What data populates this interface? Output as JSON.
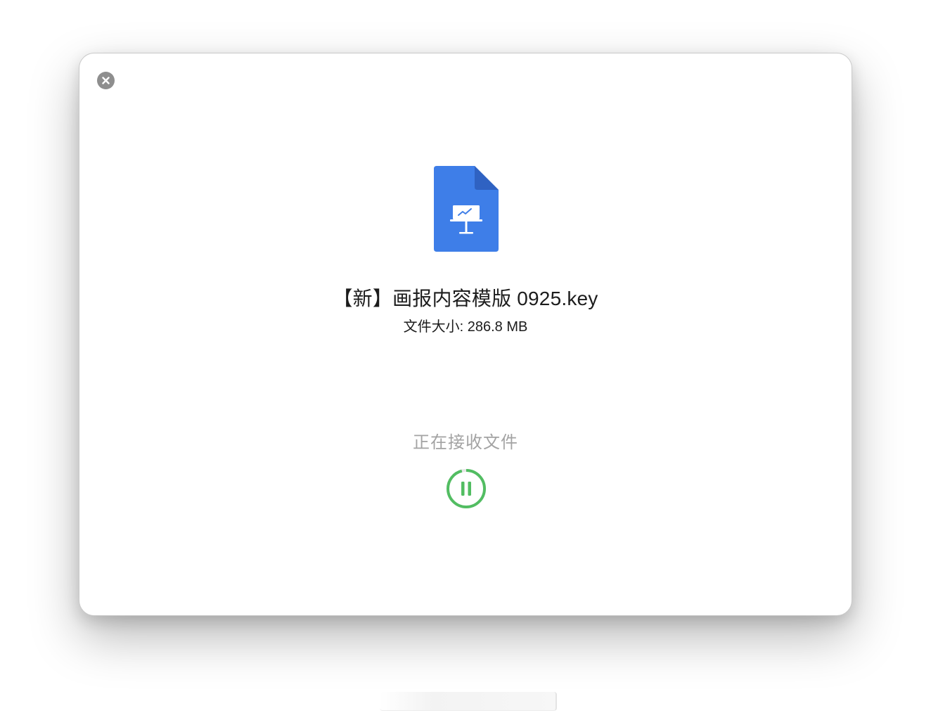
{
  "dialog": {
    "file_name": "【新】画报内容模版 0925.key",
    "file_size": "文件大小: 286.8 MB",
    "status": "正在接收文件",
    "progress_fraction": 0.96
  },
  "icons": {
    "close": "close-icon",
    "file": "keynote-file-icon",
    "pause": "pause-icon"
  },
  "colors": {
    "file_blue": "#3e7ee8",
    "file_fold": "#2f62c2",
    "progress_green": "#52bd62",
    "track_gray": "#e6e6e6",
    "close_gray": "#8e8e8e"
  }
}
